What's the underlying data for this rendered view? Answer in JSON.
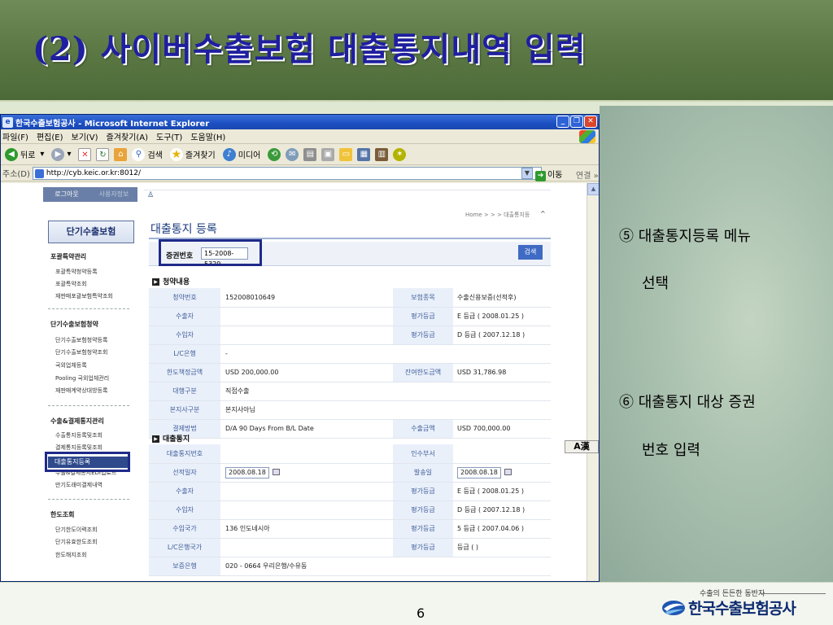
{
  "slide": {
    "title": "(2) 사이버수출보험 대출통지내역 입력",
    "page_number": "6",
    "notes": [
      {
        "line1": "⑤ 대출통지등록 메뉴",
        "line2": "선택"
      },
      {
        "line1": "⑥ 대출통지 대상 증권",
        "line2": "번호 입력"
      }
    ],
    "brand_tagline": "수출의 든든한 동반자",
    "brand_name": "한국수출보험공사"
  },
  "browser": {
    "title": "한국수출보험공사 - Microsoft Internet Explorer",
    "menu": [
      "파일(F)",
      "편집(E)",
      "보기(V)",
      "즐겨찾기(A)",
      "도구(T)",
      "도움말(H)"
    ],
    "toolbar": {
      "back": "뒤로",
      "search": "검색",
      "favorites": "즐겨찾기",
      "media": "미디어"
    },
    "address_label": "주소(D)",
    "url": "http://cyb.keic.or.kr:8012/",
    "go": "이동",
    "links": "연결",
    "ime": "A漢"
  },
  "site": {
    "topbar": {
      "logout": "로그아웃",
      "user_info": "사용자정보"
    },
    "product": "단기수출보험",
    "sidebar": {
      "sections": [
        {
          "title": "포괄특약관리",
          "items": [
            "포괄특약청약등록",
            "포괄특약조회",
            "재판매포괄보험특약조회"
          ]
        },
        {
          "title": "단기수출보험청약",
          "items": [
            "단기수출보험청약등록",
            "단기수출보험청약조회",
            "국외업체등록",
            "Pooling 국외업체관리",
            "재판매계약상대방등록"
          ]
        },
        {
          "title": "수출&결제통지관리",
          "items": [
            "수출통지등록및조회",
            "결제통지등록및조회",
            "대출통지등록",
            "수출&결제통지EDI업로드",
            "만기도래미결제내역"
          ]
        },
        {
          "title": "한도조회",
          "items": [
            "단기한도이력조회",
            "단기유효한도조회",
            "한도해지조회"
          ]
        }
      ]
    },
    "breadcrumb": "Home > > > 대출통지등",
    "page_heading": "대출통지 등록",
    "search": {
      "label": "증권번호",
      "value": "15-2008-5329",
      "button": "검색"
    },
    "contract_section": {
      "title": "청약내용",
      "rows": [
        {
          "l1": "청약번호",
          "v1": "152008010649",
          "l2": "보험종목",
          "v2": "수출신용보증(선적후)"
        },
        {
          "l1": "수출자",
          "v1": "",
          "l2": "평가등급",
          "v2": "E    등급 ( 2008.01.25 )"
        },
        {
          "l1": "수입자",
          "v1": "",
          "l2": "평가등급",
          "v2": "D    등급 ( 2007.12.18 )"
        },
        {
          "l1": "L/C은행",
          "v1": "    -",
          "l2": "",
          "v2": ""
        },
        {
          "l1": "한도책정금액",
          "v1": "USD           200,000.00",
          "l2": "잔여한도금액",
          "v2": "USD                 31,786.98"
        },
        {
          "l1": "대행구분",
          "v1": "직접수출",
          "l2": "",
          "v2": ""
        },
        {
          "l1": "본지사구분",
          "v1": "본지사아님",
          "l2": "",
          "v2": ""
        },
        {
          "l1": "결제방법",
          "v1": "D/A          90       Days From B/L Date",
          "l2": "수출금액",
          "v2": "USD                700,000.00"
        }
      ]
    },
    "loan_section": {
      "title": "대출통지",
      "rows": [
        {
          "l1": "대출통지번호",
          "v1": "",
          "l2": "인수부서",
          "v2": ""
        },
        {
          "l1": "선적일자",
          "v1": "2008.08.18",
          "l2": "발송일",
          "v2": "2008.08.18"
        },
        {
          "l1": "수출자",
          "v1": "",
          "l2": "평가등급",
          "v2": "E    등급 ( 2008.01.25 )"
        },
        {
          "l1": "수입자",
          "v1": "",
          "l2": "평가등급",
          "v2": "D    등급 ( 2007.12.18 )"
        },
        {
          "l1": "수입국가",
          "v1": "136      인도네시아",
          "l2": "평가등급",
          "v2": "5    등급 ( 2007.04.06 )"
        },
        {
          "l1": "L/C은행국가",
          "v1": "",
          "l2": "평가등급",
          "v2": "     등급 (              )"
        },
        {
          "l1": "보증은행",
          "v1": "020 - 0664      우리은행/수유동",
          "l2": "",
          "v2": ""
        }
      ]
    }
  }
}
